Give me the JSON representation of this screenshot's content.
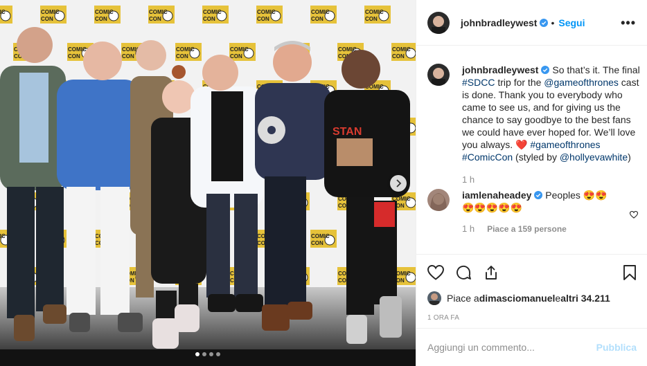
{
  "post": {
    "username": "johnbradleywest",
    "follow_label": "Segui",
    "dot_separator": "•",
    "more_label": "•••"
  },
  "caption": {
    "username": "johnbradleywest",
    "t1": " So that’s it. The final ",
    "tag_sdcc": "#SDCC",
    "t2": " trip for the ",
    "mention_got": "@gameofthrones",
    "t3": " cast is done. Thank you to everybody who came to see us, and for giving us the chance to say goodbye to the best fans we could have ever hoped for. We’ll love you always. ",
    "heart": "❤️",
    "t4": " ",
    "tag_got": "#gameofthrones",
    "t5": " ",
    "tag_comiccon": "#ComicCon",
    "t6": " (styled by ",
    "mention_stylist": "@hollyevawhite",
    "t7": ")",
    "time": "1 h"
  },
  "comment": {
    "username": "iamlenaheadey",
    "text": " Peoples 😍😍",
    "text2": "😍😍😍😍😍",
    "time": "1 h",
    "likes": "Piace a 159 persone"
  },
  "likes": {
    "prefix": "Piace a ",
    "user": "dimasciomanuel",
    "mid": " e ",
    "others": "altri 34.211"
  },
  "timestamp": "1 ORA FA",
  "add_comment": {
    "placeholder": "Aggiungi un commento...",
    "post_label": "Pubblica"
  },
  "photo": {
    "backdrop_text": "COMIC CON",
    "shirt_text": "STAN",
    "carousel_dots": 4,
    "active_dot": 0
  },
  "colors": {
    "accent": "#0095f6",
    "link": "#00376b",
    "muted": "#8e8e8e",
    "verified": "#3897f0",
    "heart": "#ed4956"
  }
}
